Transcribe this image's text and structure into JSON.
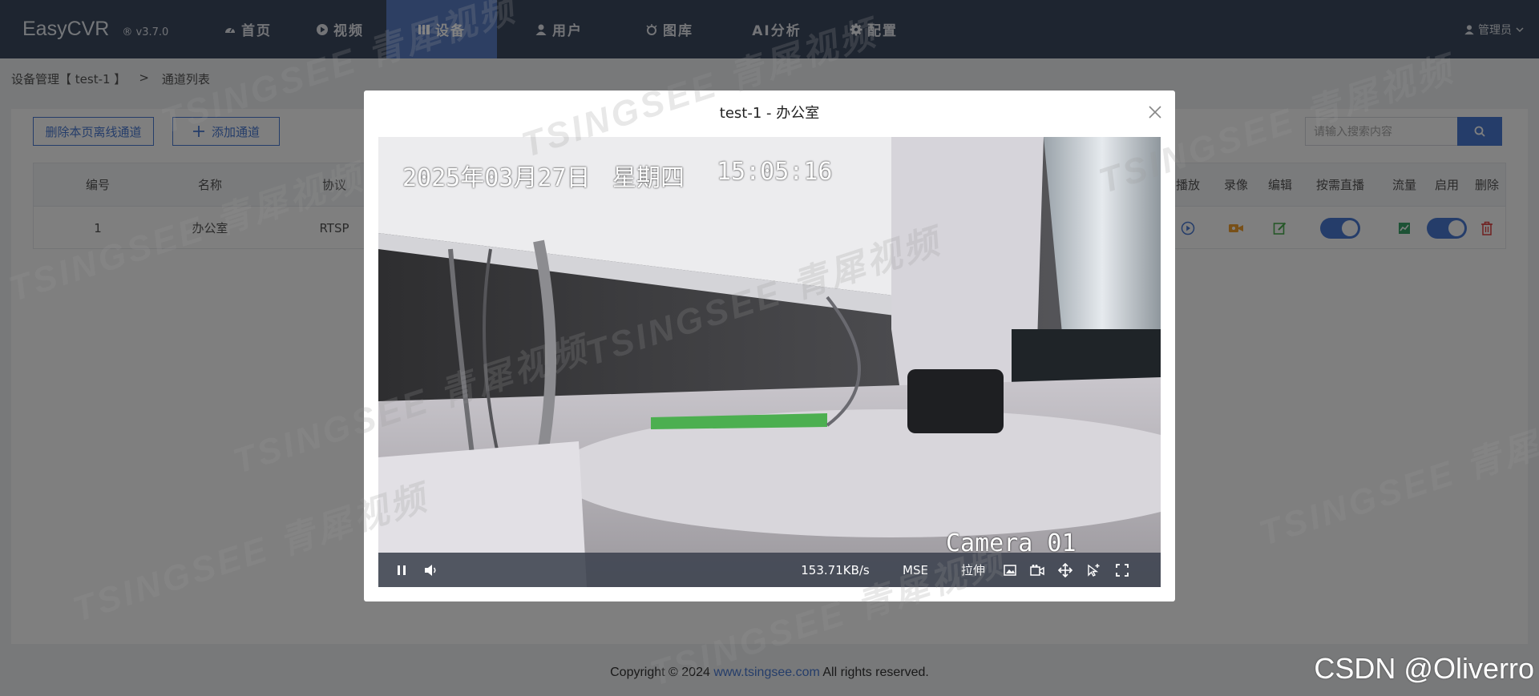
{
  "app": {
    "name": "EasyCVR",
    "version": "® v3.7.0"
  },
  "nav": {
    "items": [
      {
        "label": "首页",
        "icon": "dashboard-icon"
      },
      {
        "label": "视频",
        "icon": "play-circle-icon"
      },
      {
        "label": "设备",
        "icon": "device-icon",
        "active": true
      },
      {
        "label": "用户",
        "icon": "user-icon"
      },
      {
        "label": "图库",
        "icon": "picture-icon"
      },
      {
        "label": "AI分析",
        "icon": ""
      },
      {
        "label": "配置",
        "icon": "gear-icon"
      }
    ],
    "user": "管理员"
  },
  "breadcrumb": {
    "parent": "设备管理【 test-1 】",
    "separator": ">",
    "current": "通道列表"
  },
  "toolbar": {
    "delete_offline": "删除本页离线通道",
    "add_channel": "添加通道",
    "search_placeholder": "请输入搜索内容"
  },
  "table": {
    "headers": {
      "id": "编号",
      "name": "名称",
      "protocol": "协议",
      "playback": "播放",
      "record": "录像",
      "edit": "编辑",
      "on_demand": "按需直播",
      "traffic": "流量",
      "enable": "启用",
      "delete": "删除"
    },
    "rows": [
      {
        "id": "1",
        "name": "办公室",
        "protocol": "RTSP",
        "on_demand": true,
        "enabled": true
      }
    ]
  },
  "modal": {
    "title": "test-1 - 办公室",
    "osd_date": "2025年03月27日",
    "osd_weekday": "星期四",
    "osd_time": "15:05:16",
    "osd_camera": "Camera 01",
    "bitrate": "153.71KB/s",
    "mode": "MSE",
    "stretch": "拉伸"
  },
  "footer": {
    "prefix": "Copyright © 2024 ",
    "link": "www.tsingsee.com",
    "suffix": " All rights reserved."
  },
  "watermark": {
    "brand": "TSINGSEE",
    "cn": "青犀视频"
  },
  "csdn": "CSDN @Oliverro",
  "colors": {
    "nav_bg": "#3c4a61",
    "nav_active": "#5b7fc6",
    "accent": "#4a7bd4",
    "record_icon": "#f0a030",
    "edit_icon": "#4caf50",
    "delete_icon": "#e04040"
  }
}
